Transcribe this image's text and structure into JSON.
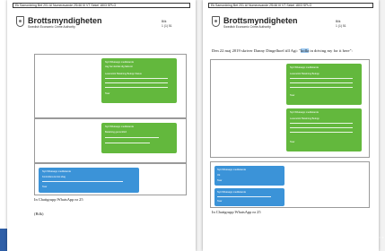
{
  "colors": {
    "accent_green": "#63b83d",
    "accent_blue": "#3b93d8",
    "bottom_band": "#2f5fa7",
    "highlight": "#9cc8ef"
  },
  "document": {
    "header_text": "Ek Samordning Bet 201 AI Numeravande 2S/46 III VT Sekel 1803 SPLG",
    "brand_name": "Brottsmyndigheten",
    "brand_tagline": "Swedish Economic Crime Authority",
    "meta_label": "Bilk",
    "meta_page_left": "1 (1) 51",
    "meta_page_right": "1 (1) 51"
  },
  "page_left": {
    "caption": "In Chattgrupp WhatsApp nr 25",
    "note": "(Bilk)",
    "bubble_top": {
      "lines": [
        "Nytt Whatsapp meddelande",
        "Jag har skickat dig fakturor",
        "Leverantör Betalning Belopp Status",
        "Svar"
      ]
    },
    "bubble_middle": {
      "lines": [
        "Nytt Whatsapp meddelande",
        "Betalning genomförd"
      ]
    },
    "bubble_blue": {
      "lines": [
        "Nytt Whatsapp meddelande",
        "Kontrollera kontot idag",
        "Svar"
      ]
    }
  },
  "page_right": {
    "body_prefix": "Den 22 maj 2019 skriver Danny Dingelhoel till Agi: \"",
    "body_highlight": "kolla",
    "body_suffix": " in driving my for it here\":",
    "caption": "In Chattgrupp WhatsApp nr 25",
    "bubble_top": {
      "lines": [
        "Nytt Whatsapp meddelande",
        "Leverantör Betalning Belopp",
        "Svar"
      ]
    },
    "bubble_second": {
      "lines": [
        "Nytt Whatsapp meddelande",
        "Leverantör Betalning Belopp",
        "Svar"
      ]
    },
    "bubble_blue_one": {
      "lines": [
        "Nytt Whatsapp meddelande",
        "Ok",
        "Svar"
      ]
    },
    "bubble_blue_two": {
      "lines": [
        "Nytt Whatsapp meddelande",
        "Svar"
      ]
    }
  },
  "edge_mark": "n\ne"
}
